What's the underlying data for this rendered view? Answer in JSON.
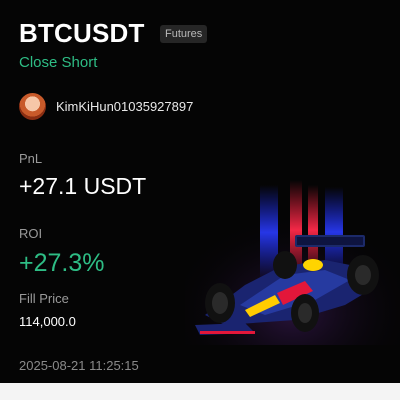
{
  "header": {
    "symbol": "BTCUSDT",
    "badge": "Futures",
    "side": "Close Short"
  },
  "user": {
    "name": "KimKiHun01035927897"
  },
  "stats": {
    "pnl_label": "PnL",
    "pnl_value": "+27.1 USDT",
    "roi_label": "ROI",
    "roi_value": "+27.3%",
    "fill_price_label": "Fill Price",
    "fill_price_value": "114,000.0"
  },
  "timestamp": "2025-08-21 11:25:15",
  "colors": {
    "positive": "#2ebd85",
    "background": "#050505",
    "badge_bg": "#262626"
  }
}
